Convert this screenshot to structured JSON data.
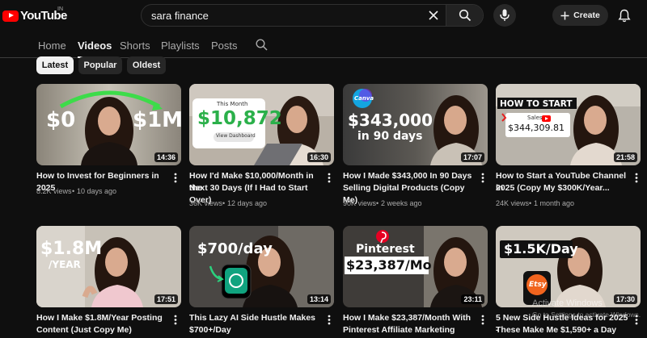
{
  "app": {
    "logo_text": "YouTube",
    "country_code": "IN",
    "accent": "#ff0000"
  },
  "search": {
    "query": "sara finance",
    "placeholder": "Search"
  },
  "header": {
    "create_label": "Create"
  },
  "tabs": [
    {
      "label": "Home",
      "active": false
    },
    {
      "label": "Videos",
      "active": true
    },
    {
      "label": "Shorts",
      "active": false
    },
    {
      "label": "Playlists",
      "active": false
    },
    {
      "label": "Posts",
      "active": false
    }
  ],
  "chips": [
    {
      "label": "Latest",
      "active": true
    },
    {
      "label": "Popular",
      "active": false
    },
    {
      "label": "Oldest",
      "active": false
    }
  ],
  "videos": [
    {
      "title_line1": "How to Invest for Beginners in 2025",
      "title_line2": "",
      "views": "8.2K views",
      "age": "10 days ago",
      "duration": "14:36",
      "thumb_text": {
        "left": "$0",
        "right": "$1M"
      }
    },
    {
      "title_line1": "How I'd Make $10,000/Month in the",
      "title_line2": "Next 30 Days (If I Had to Start Over)",
      "views": "36K views",
      "age": "12 days ago",
      "duration": "16:30",
      "thumb_text": {
        "caption": "This Month",
        "amount": "$10,872",
        "button": "View Dashboard"
      }
    },
    {
      "title_line1": "How I Made $343,000 In 90 Days",
      "title_line2": "Selling Digital Products (Copy Me)",
      "views": "90K views",
      "age": "2 weeks ago",
      "duration": "17:07",
      "thumb_text": {
        "badge": "Canva",
        "amount": "$343,000",
        "sub": "in 90 days"
      }
    },
    {
      "title_line1": "How to Start a YouTube Channel in",
      "title_line2": "2025 (Copy My $300K/Year...",
      "views": "24K views",
      "age": "1 month ago",
      "duration": "21:58",
      "thumb_text": {
        "headline": "HOW TO START",
        "caption": "Sales",
        "amount": "$344,309.81"
      }
    },
    {
      "title_line1": "How I Make $1.8M/Year Posting",
      "title_line2": "Content (Just Copy Me)",
      "views": "",
      "age": "",
      "duration": "17:51",
      "thumb_text": {
        "amount": "$1.8M",
        "sub": "/YEAR"
      }
    },
    {
      "title_line1": "This Lazy AI Side Hustle Makes",
      "title_line2": "$700+/Day",
      "views": "",
      "age": "",
      "duration": "13:14",
      "thumb_text": {
        "amount": "$700/day"
      }
    },
    {
      "title_line1": "How I Make $23,387/Month With",
      "title_line2": "Pinterest Affiliate Marketing (New...",
      "views": "",
      "age": "",
      "duration": "23:11",
      "thumb_text": {
        "brand": "Pinterest",
        "amount": "$23,387/Mo"
      }
    },
    {
      "title_line1": "5 New Side Hustle Ideas for 2025 -",
      "title_line2": "These Make Me $1,590+ a Day",
      "views": "",
      "age": "",
      "duration": "17:30",
      "thumb_text": {
        "amount": "$1.5K/Day",
        "badge": "Etsy"
      }
    }
  ],
  "watermark": {
    "title": "Activate Windows",
    "subtitle": "Go to Settings to activate Windows."
  },
  "icons": [
    "youtube-logo-icon",
    "clear-icon",
    "search-icon",
    "microphone-icon",
    "plus-icon",
    "bell-icon",
    "more-vert-icon"
  ]
}
